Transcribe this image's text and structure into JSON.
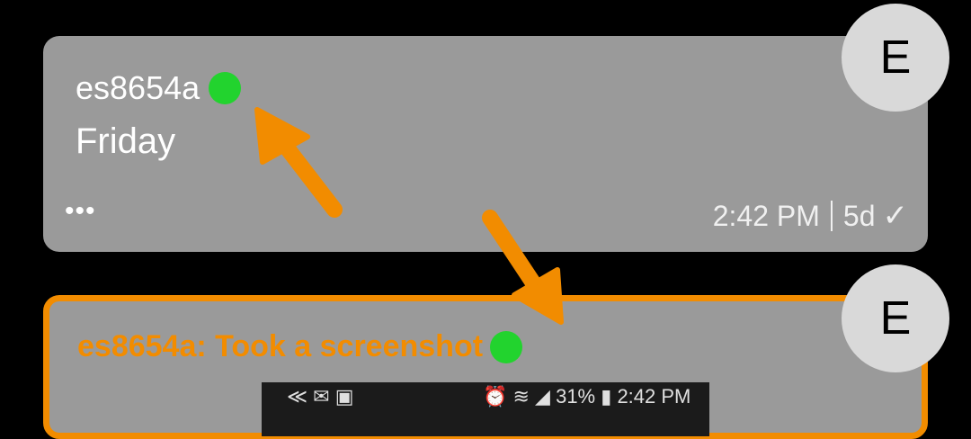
{
  "messages": [
    {
      "sender": "es8654a",
      "text": "Friday",
      "more": "•••",
      "time": "2:42 PM",
      "age": "5d",
      "status_icon": "check-icon",
      "avatar": "E",
      "online": true
    },
    {
      "sender": "es8654a: Took a screenshot",
      "avatar": "E",
      "online": true,
      "thumbnail_status": {
        "left_icons": "≪ ✉ ▣",
        "right_text": "⏰ ≋ ◢ 31% ▮ 2:42 PM"
      }
    }
  ],
  "colors": {
    "background": "#000000",
    "card": "#9a9a9a",
    "highlight": "#f28c00",
    "online_dot": "#22d32e",
    "avatar_bg": "#d9d9d9"
  }
}
